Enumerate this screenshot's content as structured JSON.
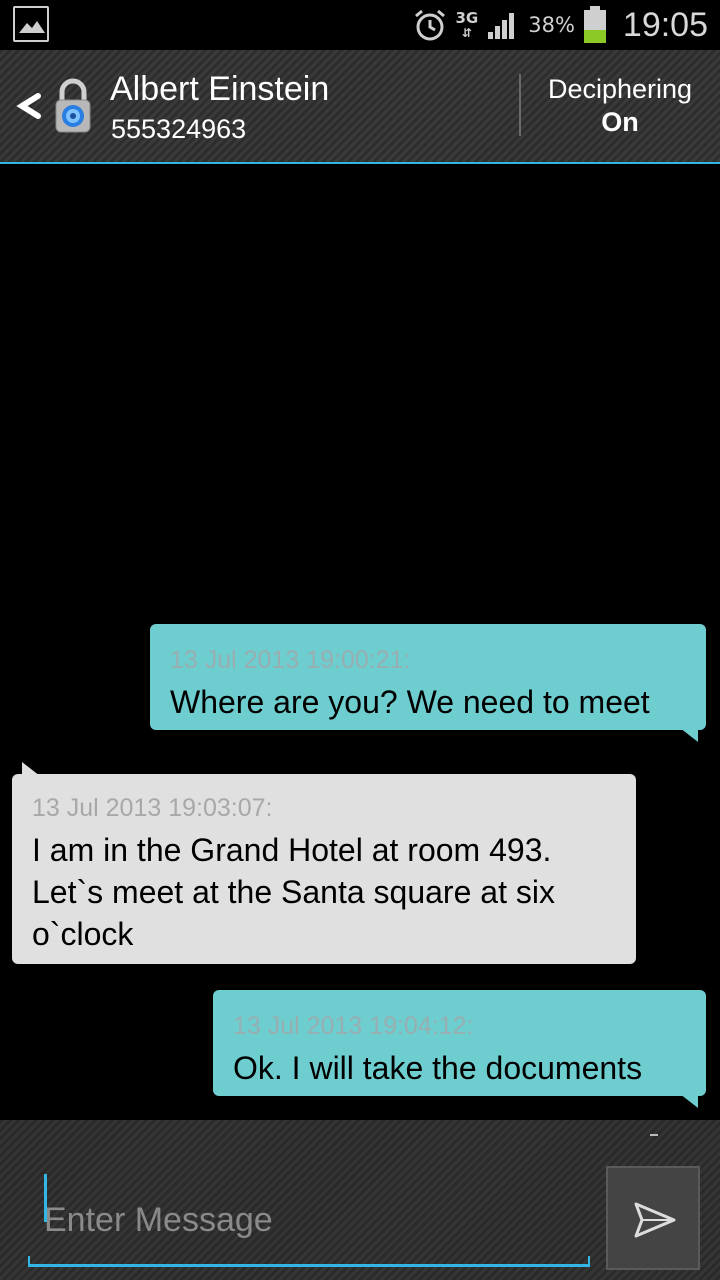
{
  "status_bar": {
    "network": "3G",
    "battery_percent": "38%",
    "time": "19:05",
    "icons": [
      "gallery-icon",
      "alarm-icon",
      "data-arrows-icon",
      "signal-icon",
      "battery-icon"
    ]
  },
  "header": {
    "contact_name": "Albert Einstein",
    "contact_number": "555324963",
    "deciphering_label": "Deciphering",
    "deciphering_state": "On",
    "accent": "#33b5e5"
  },
  "messages": [
    {
      "direction": "out",
      "timestamp": "13 Jul 2013 19:00:21:",
      "text": "Where are you? We need to meet"
    },
    {
      "direction": "in",
      "timestamp": "13 Jul 2013 19:03:07:",
      "text": "I am in the Grand Hotel at room 493. Let`s meet at the Santa square at six o`clock"
    },
    {
      "direction": "out",
      "timestamp": "13 Jul 2013 19:04:12:",
      "text": "Ok. I will take the documents"
    }
  ],
  "composer": {
    "placeholder": "Enter Message",
    "value": ""
  },
  "colors": {
    "outgoing_bubble": "#6ecdcf",
    "incoming_bubble": "#e0e0e0"
  }
}
